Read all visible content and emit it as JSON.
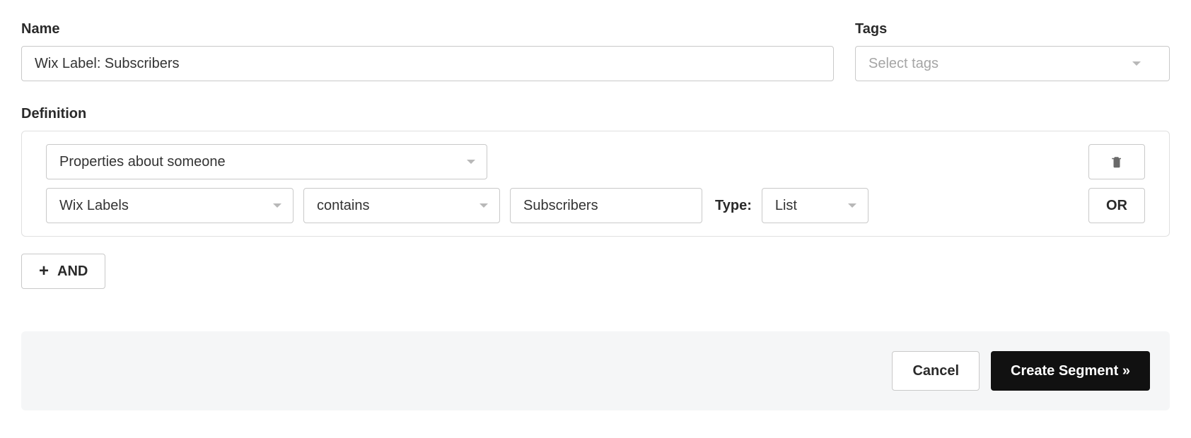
{
  "name": {
    "label": "Name",
    "value": "Wix Label: Subscribers"
  },
  "tags": {
    "label": "Tags",
    "placeholder": "Select tags"
  },
  "definition": {
    "label": "Definition",
    "condition_type": "Properties about someone",
    "property": "Wix Labels",
    "operator": "contains",
    "value": "Subscribers",
    "type_label": "Type:",
    "type_value": "List",
    "or_label": "OR",
    "and_label": "AND"
  },
  "footer": {
    "cancel": "Cancel",
    "create": "Create Segment »"
  }
}
